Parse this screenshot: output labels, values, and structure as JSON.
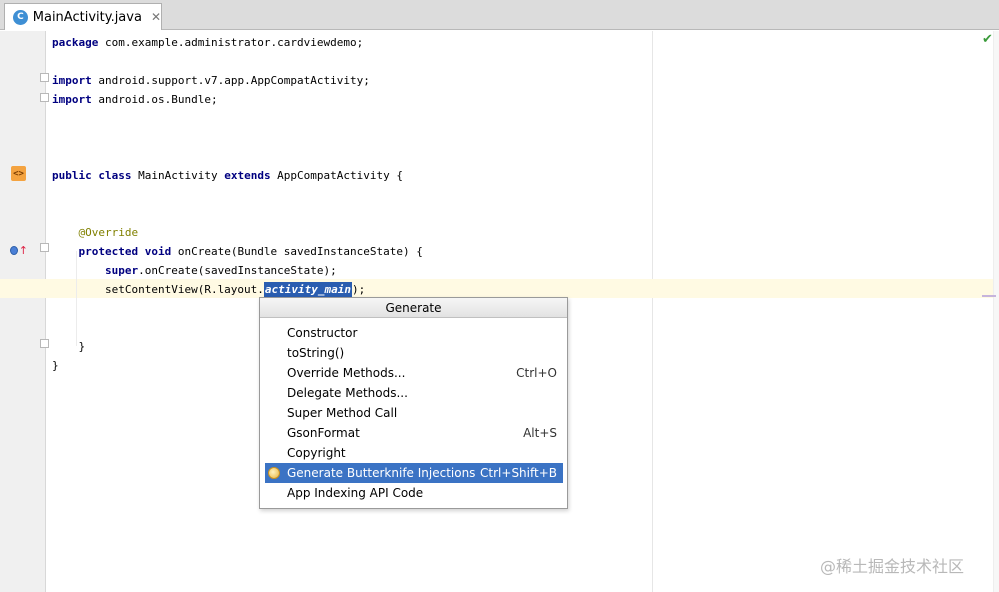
{
  "tab": {
    "title": "MainActivity.java",
    "icon": "C",
    "close": "✕"
  },
  "code_lines": [
    [
      {
        "t": "package",
        "c": "kw"
      },
      {
        "t": " com.example.administrator.cardviewdemo;"
      }
    ],
    [],
    [
      {
        "t": "import",
        "c": "kw"
      },
      {
        "t": " android.support.v7.app.AppCompatActivity;"
      }
    ],
    [
      {
        "t": "import",
        "c": "kw"
      },
      {
        "t": " android.os.Bundle;"
      }
    ],
    [],
    [],
    [],
    [
      {
        "t": "public class",
        "c": "kw"
      },
      {
        "t": " MainActivity "
      },
      {
        "t": "extends",
        "c": "kw"
      },
      {
        "t": " AppCompatActivity {"
      }
    ],
    [],
    [],
    [
      {
        "t": "    "
      },
      {
        "t": "@Override",
        "c": "ann"
      }
    ],
    [
      {
        "t": "    "
      },
      {
        "t": "protected void",
        "c": "kw"
      },
      {
        "t": " onCreate(Bundle savedInstanceState) {"
      }
    ],
    [
      {
        "t": "        "
      },
      {
        "t": "super",
        "c": "kw"
      },
      {
        "t": ".onCreate(savedInstanceState);"
      }
    ],
    [
      {
        "t": "        setContentView(R.layout."
      },
      {
        "t": "activity_main",
        "c": "sel"
      },
      {
        "t": ");"
      }
    ],
    [],
    [],
    [
      {
        "t": "    }"
      }
    ],
    [
      {
        "t": "}"
      }
    ]
  ],
  "popup": {
    "title": "Generate",
    "items": [
      {
        "label": "Constructor",
        "shortcut": ""
      },
      {
        "label": "toString()",
        "shortcut": ""
      },
      {
        "label": "Override Methods...",
        "shortcut": "Ctrl+O"
      },
      {
        "label": "Delegate Methods...",
        "shortcut": ""
      },
      {
        "label": "Super Method Call",
        "shortcut": ""
      },
      {
        "label": "GsonFormat",
        "shortcut": "Alt+S"
      },
      {
        "label": "Copyright",
        "shortcut": ""
      },
      {
        "label": "Generate Butterknife Injections",
        "shortcut": "Ctrl+Shift+B",
        "selected": true,
        "icon": "butterknife-icon"
      },
      {
        "label": "App Indexing API Code",
        "shortcut": ""
      }
    ]
  },
  "watermark": "@稀土掘金技术社区",
  "colors": {
    "selection": "#3b73c4",
    "keyword": "#000080",
    "annotation": "#808000",
    "current_line": "#fffae3"
  }
}
